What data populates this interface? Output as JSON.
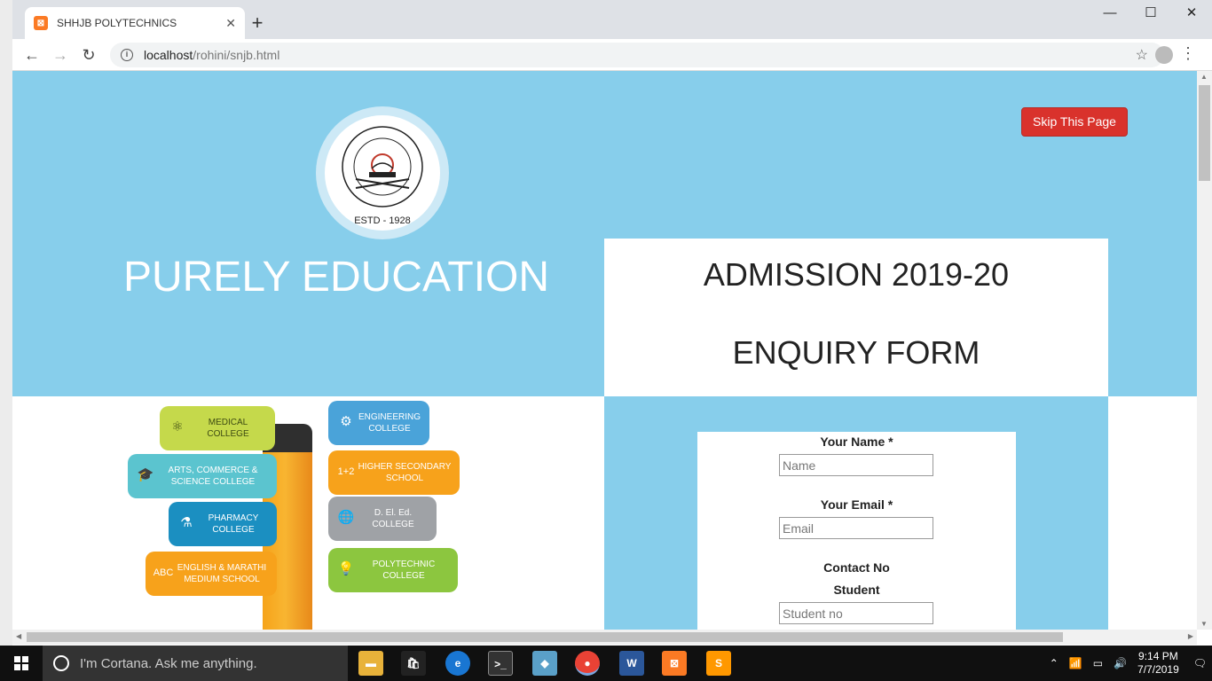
{
  "browser": {
    "tab_title": "SHHJB POLYTECHNICS",
    "tab_close": "✕",
    "new_tab": "+",
    "url_host": "localhost",
    "url_path": "/rohini/snjb.html",
    "window_buttons": [
      "—",
      "☐",
      "✕"
    ]
  },
  "header": {
    "logo_estd": "ESTD - 1928",
    "skip_button": "Skip This Page",
    "tagline": "PURELY EDUCATION",
    "admission_title": "ADMISSION 2019-20",
    "enquiry_title": "ENQUIRY FORM"
  },
  "form": {
    "name_label": "Your Name *",
    "name_placeholder": "Name",
    "email_label": "Your Email *",
    "email_placeholder": "Email",
    "contact_label": "Contact No",
    "student_label": "Student",
    "student_placeholder": "Student no"
  },
  "illustration": {
    "items": [
      {
        "label": "MEDICAL COLLEGE",
        "color": "#c5d94b",
        "icon": "atom-icon"
      },
      {
        "label": "ENGINEERING COLLEGE",
        "color": "#4aa3d9",
        "icon": "gear-icon"
      },
      {
        "label": "ARTS, COMMERCE & SCIENCE COLLEGE",
        "color": "#5bc4cf",
        "icon": "graduation-cap-icon"
      },
      {
        "label": "HIGHER SECONDARY SCHOOL",
        "color": "#f7a21b",
        "icon": "one-plus-two-icon"
      },
      {
        "label": "PHARMACY COLLEGE",
        "color": "#1b8fc1",
        "icon": "flask-icon"
      },
      {
        "label": "D. El. Ed. COLLEGE",
        "color": "#9fa2a6",
        "icon": "globe-icon"
      },
      {
        "label": "ENGLISH & MARATHI MEDIUM SCHOOL",
        "color": "#f7a21b",
        "icon": "abc-icon"
      },
      {
        "label": "POLYTECHNIC COLLEGE",
        "color": "#8cc63f",
        "icon": "bulb-icon"
      }
    ]
  },
  "taskbar": {
    "cortana_placeholder": "I'm Cortana. Ask me anything.",
    "time": "9:14 PM",
    "date": "7/7/2019"
  }
}
